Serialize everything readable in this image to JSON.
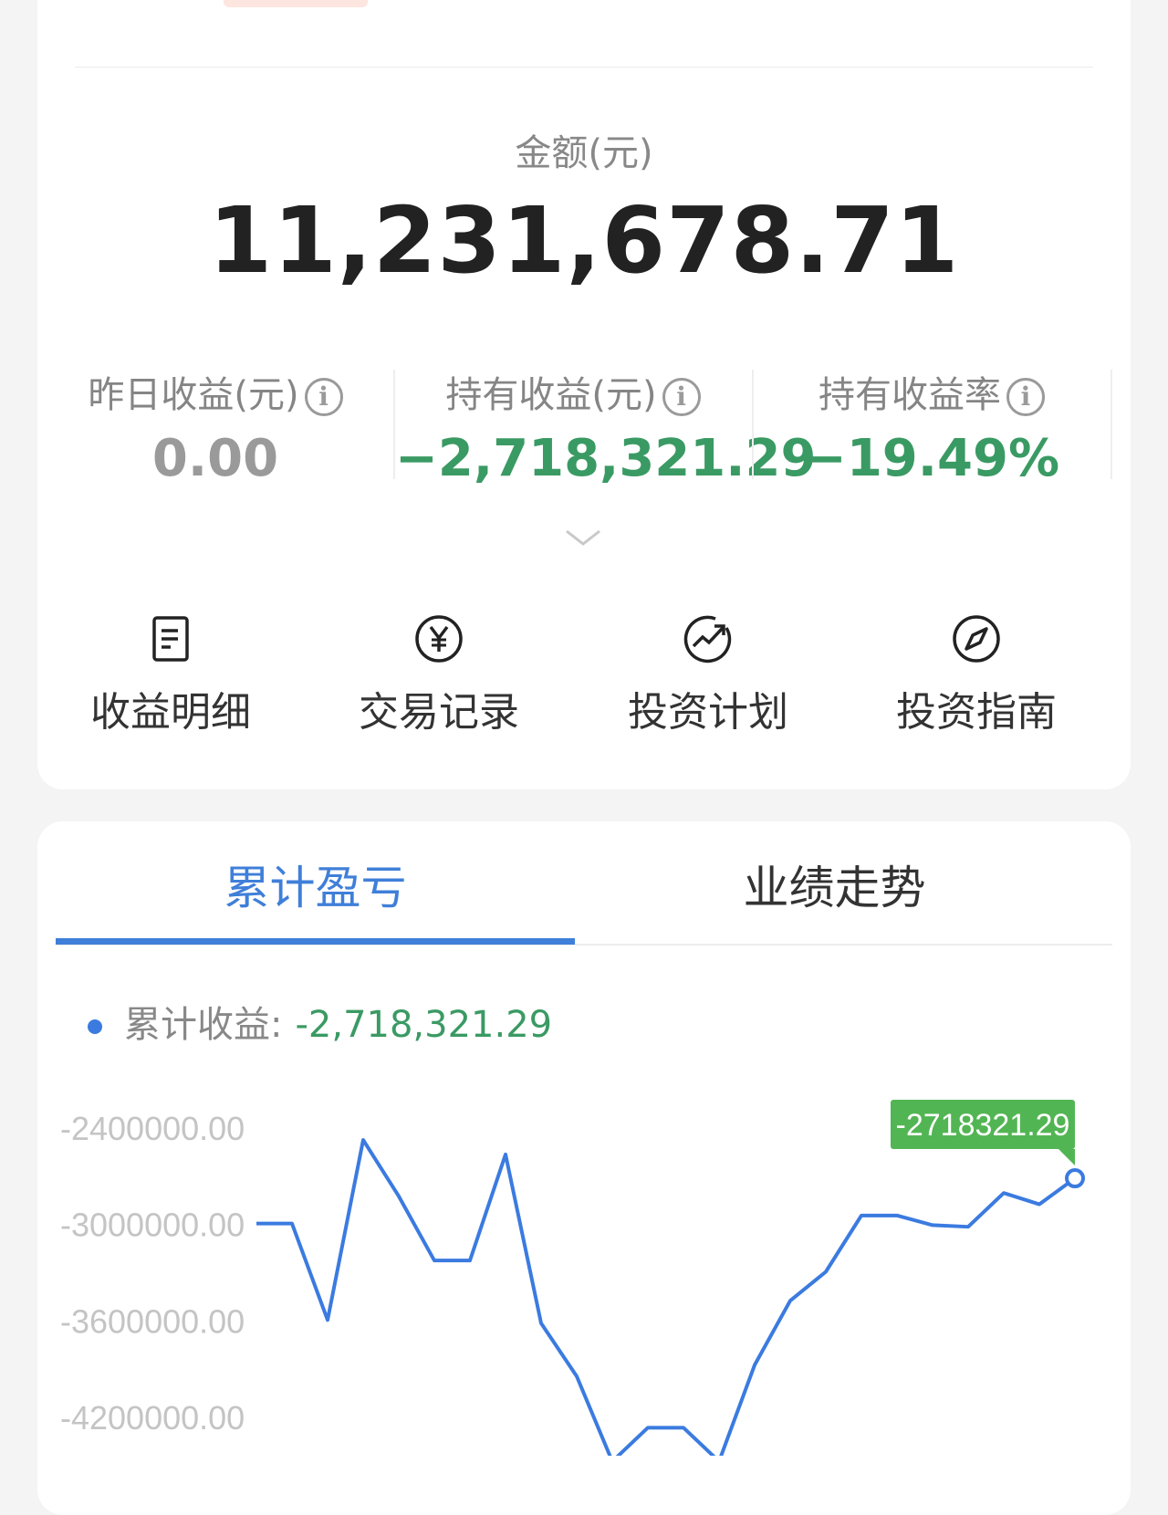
{
  "summary": {
    "amount_label": "金额(元)",
    "amount_value": "11,231,678.71",
    "stats": [
      {
        "label": "昨日收益(元)",
        "value": "0.00",
        "color": "#9a9a9a"
      },
      {
        "label": "持有收益(元)",
        "value": "−2,718,321.29",
        "color": "#3a9a63"
      },
      {
        "label": "持有收益率",
        "value": "−19.49%",
        "color": "#3a9a63"
      }
    ],
    "info_icon": "i",
    "actions": [
      {
        "label": "收益明细",
        "icon": "document-icon"
      },
      {
        "label": "交易记录",
        "icon": "yuan-circle-icon"
      },
      {
        "label": "投资计划",
        "icon": "trend-circle-icon"
      },
      {
        "label": "投资指南",
        "icon": "compass-icon"
      }
    ]
  },
  "tabs": [
    {
      "label": "累计盈亏",
      "active": true
    },
    {
      "label": "业绩走势",
      "active": false
    }
  ],
  "legend": {
    "label": "累计收益:",
    "value": "-2,718,321.29"
  },
  "chart_data": {
    "type": "line",
    "y_ticks": [
      "-2400000.00",
      "-3000000.00",
      "-3600000.00",
      "-4200000.00"
    ],
    "ylim": [
      -4200000,
      -2400000
    ],
    "series": [
      {
        "color": "#3b7be0",
        "values": [
          -3000000,
          -3000000,
          -3600000,
          -2480000,
          -2830000,
          -3230000,
          -3230000,
          -2570000,
          -3620000,
          -3950000,
          -4480000,
          -4270000,
          -4270000,
          -4480000,
          -3880000,
          -3480000,
          -3300000,
          -2950000,
          -2950000,
          -3010000,
          -3020000,
          -2810000,
          -2880000,
          -2718321.29
        ]
      }
    ],
    "tooltip": {
      "label": "-2718321.29",
      "color": "#52b553"
    },
    "colors": {
      "accent": "#3b7be0",
      "gain_loss": "#3a9a63"
    }
  }
}
